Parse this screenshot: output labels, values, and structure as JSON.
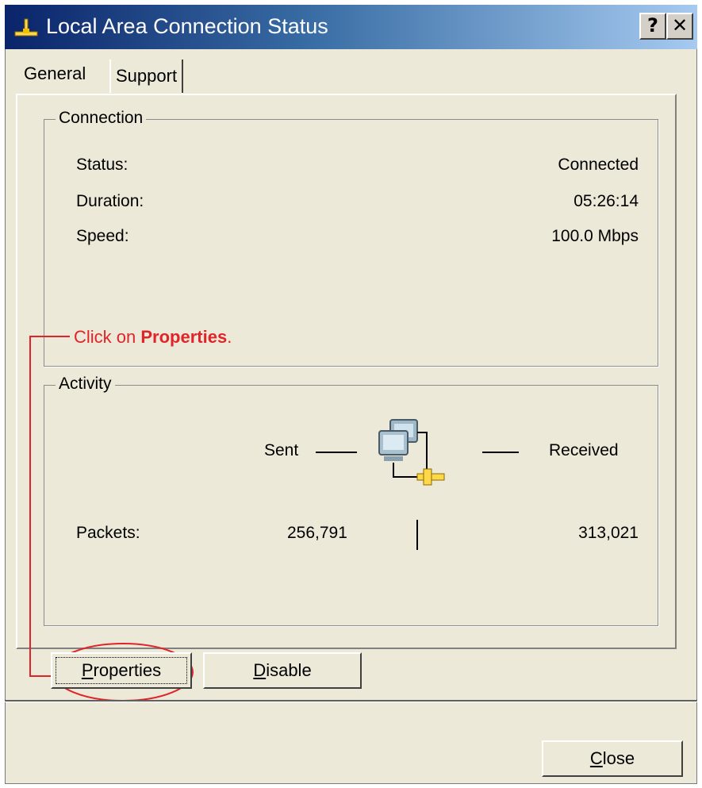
{
  "window": {
    "title": "Local Area Connection Status",
    "help_label": "?",
    "close_label": "✕"
  },
  "tabs": [
    {
      "label": "General",
      "active": true
    },
    {
      "label": "Support",
      "active": false
    }
  ],
  "connection": {
    "legend": "Connection",
    "status_label": "Status:",
    "status_value": "Connected",
    "duration_label": "Duration:",
    "duration_value": "05:26:14",
    "speed_label": "Speed:",
    "speed_value": "100.0 Mbps"
  },
  "annotation": {
    "prefix": "Click on ",
    "emphasis": "Properties",
    "suffix": ".",
    "color": "#e0242a"
  },
  "activity": {
    "legend": "Activity",
    "sent_label": "Sent",
    "received_label": "Received",
    "packets_label": "Packets:",
    "packets_sent": "256,791",
    "packets_received": "313,021"
  },
  "buttons": {
    "properties_mnemonic": "P",
    "properties_rest": "roperties",
    "disable_mnemonic": "D",
    "disable_rest": "isable",
    "close_mnemonic": "C",
    "close_rest": "lose"
  },
  "icons": {
    "title_icon": "network-connection-icon",
    "activity_icon": "network-computers-icon"
  }
}
